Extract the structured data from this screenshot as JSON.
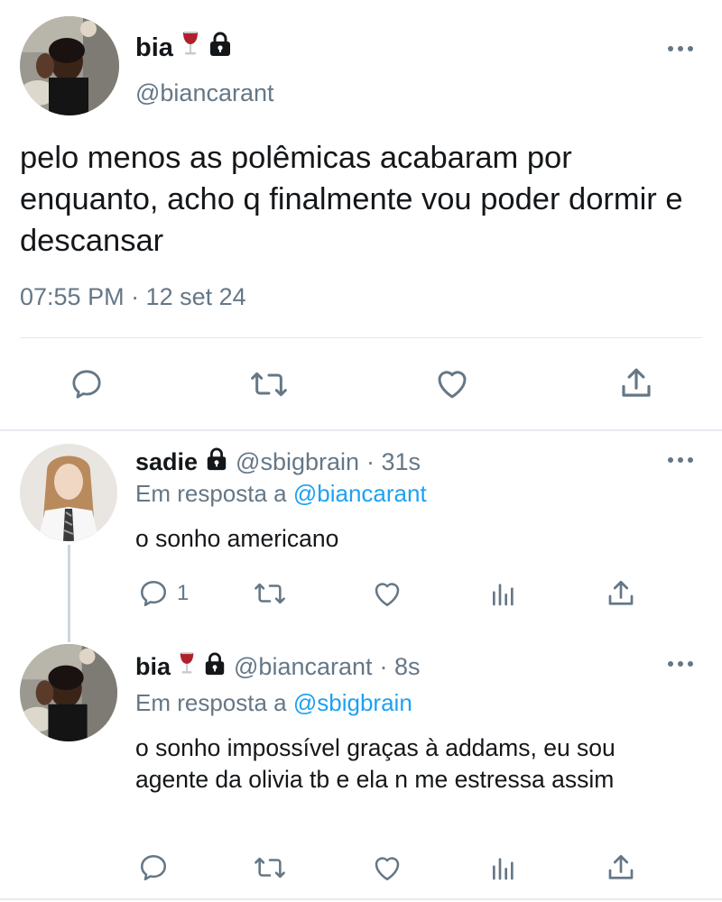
{
  "main_tweet": {
    "name": "bia",
    "handle": "@biancarant",
    "text": "pelo menos as polêmicas acabaram por enquanto, acho q finalmente vou poder dormir e descansar",
    "timestamp": "07:55 PM · 12 set 24",
    "icons": [
      "wine-glass-icon",
      "lock-icon",
      "more-icon",
      "reply-icon",
      "retweet-icon",
      "like-icon",
      "share-icon"
    ]
  },
  "replies": [
    {
      "name": "sadie",
      "handle": "@sbigbrain",
      "time": "· 31s",
      "replying_prefix": "Em resposta a",
      "replying_to": "@biancarant",
      "text": "o sonho americano",
      "reply_count": "1"
    },
    {
      "name": "bia",
      "handle": "@biancarant",
      "time": "· 8s",
      "replying_prefix": "Em resposta a",
      "replying_to": "@sbigbrain",
      "text": "o sonho impossível graças à addams, eu sou agente da olivia tb e ela n me estressa assim",
      "reply_count": ""
    }
  ],
  "colors": {
    "text": "#14171a",
    "secondary": "#657786",
    "link": "#1da1f2",
    "divider": "#e1e8ed",
    "wine": "#b0202c"
  }
}
